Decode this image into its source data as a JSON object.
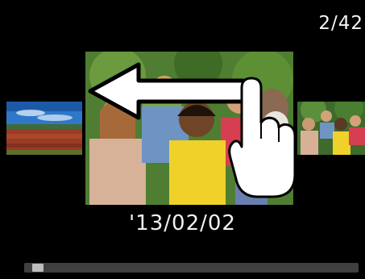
{
  "playback": {
    "image_counter": "2/42",
    "date": "'13/02/02",
    "scroll_position": 0.02
  },
  "icons": {
    "swipe": "left-arrow-icon",
    "hand": "pointing-hand-icon"
  },
  "colors": {
    "background": "#000000",
    "text": "#f2f2f2",
    "scroll_track": "#3f3f3f",
    "scroll_thumb": "#bdbdbd"
  }
}
